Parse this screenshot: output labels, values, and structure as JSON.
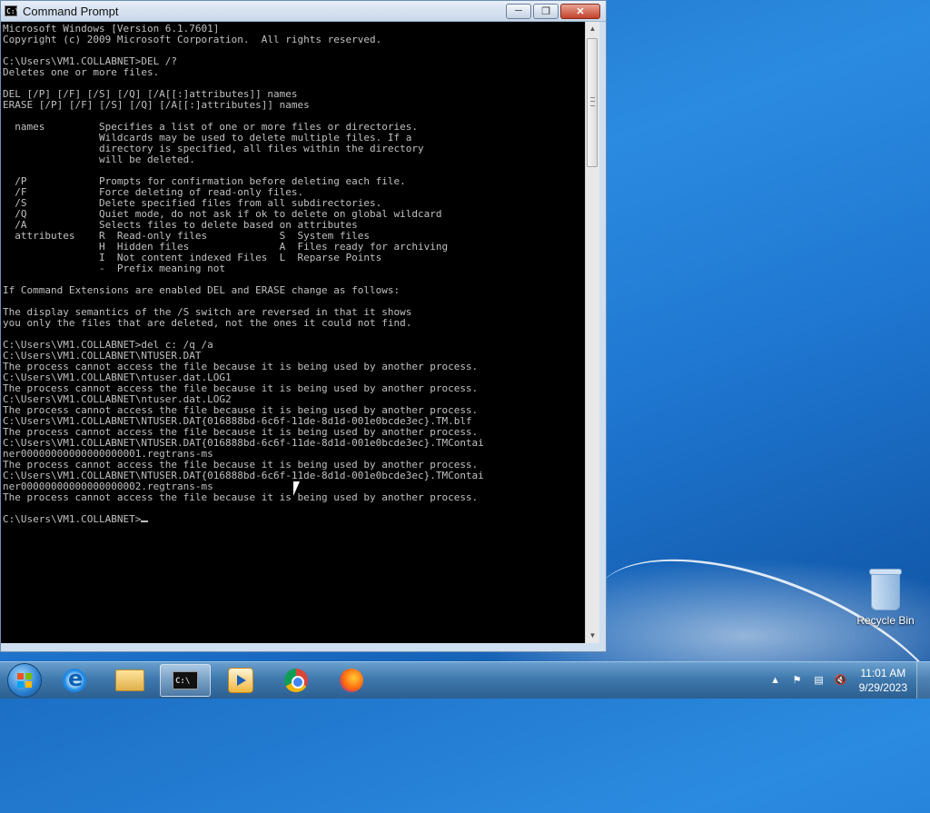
{
  "window": {
    "title": "Command Prompt",
    "icon_text": "C:\\",
    "controls": {
      "minimize": "─",
      "maximize": "❐",
      "close": "✕"
    }
  },
  "console": {
    "lines": [
      "Microsoft Windows [Version 6.1.7601]",
      "Copyright (c) 2009 Microsoft Corporation.  All rights reserved.",
      "",
      "C:\\Users\\VM1.COLLABNET>DEL /?",
      "Deletes one or more files.",
      "",
      "DEL [/P] [/F] [/S] [/Q] [/A[[:]attributes]] names",
      "ERASE [/P] [/F] [/S] [/Q] [/A[[:]attributes]] names",
      "",
      "  names         Specifies a list of one or more files or directories.",
      "                Wildcards may be used to delete multiple files. If a",
      "                directory is specified, all files within the directory",
      "                will be deleted.",
      "",
      "  /P            Prompts for confirmation before deleting each file.",
      "  /F            Force deleting of read-only files.",
      "  /S            Delete specified files from all subdirectories.",
      "  /Q            Quiet mode, do not ask if ok to delete on global wildcard",
      "  /A            Selects files to delete based on attributes",
      "  attributes    R  Read-only files            S  System files",
      "                H  Hidden files               A  Files ready for archiving",
      "                I  Not content indexed Files  L  Reparse Points",
      "                -  Prefix meaning not",
      "",
      "If Command Extensions are enabled DEL and ERASE change as follows:",
      "",
      "The display semantics of the /S switch are reversed in that it shows",
      "you only the files that are deleted, not the ones it could not find.",
      "",
      "C:\\Users\\VM1.COLLABNET>del c: /q /a",
      "C:\\Users\\VM1.COLLABNET\\NTUSER.DAT",
      "The process cannot access the file because it is being used by another process.",
      "C:\\Users\\VM1.COLLABNET\\ntuser.dat.LOG1",
      "The process cannot access the file because it is being used by another process.",
      "C:\\Users\\VM1.COLLABNET\\ntuser.dat.LOG2",
      "The process cannot access the file because it is being used by another process.",
      "C:\\Users\\VM1.COLLABNET\\NTUSER.DAT{016888bd-6c6f-11de-8d1d-001e0bcde3ec}.TM.blf",
      "The process cannot access the file because it is being used by another process.",
      "C:\\Users\\VM1.COLLABNET\\NTUSER.DAT{016888bd-6c6f-11de-8d1d-001e0bcde3ec}.TMContai",
      "ner00000000000000000001.regtrans-ms",
      "The process cannot access the file because it is being used by another process.",
      "C:\\Users\\VM1.COLLABNET\\NTUSER.DAT{016888bd-6c6f-11de-8d1d-001e0bcde3ec}.TMContai",
      "ner00000000000000000002.regtrans-ms",
      "The process cannot access the file because it is being used by another process.",
      "",
      "C:\\Users\\VM1.COLLABNET>"
    ]
  },
  "desktop": {
    "recycle_bin_label": "Recycle Bin"
  },
  "taskbar": {
    "pinned": [
      {
        "name": "start-button",
        "icon": "windows-flag-icon"
      },
      {
        "name": "internet-explorer",
        "icon": "internet-explorer-icon"
      },
      {
        "name": "windows-explorer",
        "icon": "folder-icon"
      },
      {
        "name": "command-prompt",
        "icon": "command-prompt-icon",
        "active": true
      },
      {
        "name": "media-player",
        "icon": "media-player-icon"
      },
      {
        "name": "google-chrome",
        "icon": "chrome-icon"
      },
      {
        "name": "firefox",
        "icon": "firefox-icon"
      }
    ],
    "tray": {
      "show_hidden": "▲",
      "action_center": "⚑",
      "network": "▤",
      "volume": "🔇"
    },
    "clock": {
      "time": "11:01 AM",
      "date": "9/29/2023"
    }
  }
}
